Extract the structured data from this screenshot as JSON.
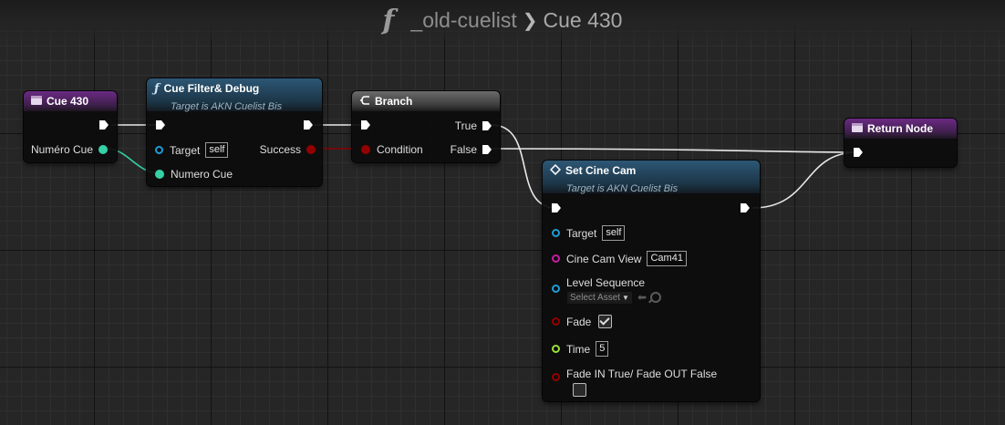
{
  "title_bar": {
    "function_glyph": "f",
    "graph_name": "_old-cuelist",
    "separator": "❯",
    "current": "Cue 430"
  },
  "nodes": {
    "cue430": {
      "title": "Cue 430",
      "icon": "event-icon",
      "pins": {
        "numero_cue": "Numéro Cue"
      }
    },
    "cue_filter": {
      "title": "Cue Filter& Debug",
      "subtitle": "Target is AKN Cuelist Bis",
      "icon": "function-icon",
      "pins": {
        "target": "Target",
        "target_value": "self",
        "success": "Success",
        "numero_cue": "Numero Cue"
      }
    },
    "branch": {
      "title": "Branch",
      "icon": "branch-icon",
      "pins": {
        "true": "True",
        "false": "False",
        "condition": "Condition"
      }
    },
    "return_node": {
      "title": "Return Node",
      "icon": "event-icon"
    },
    "set_cine_cam": {
      "title": "Set Cine Cam",
      "subtitle": "Target is AKN Cuelist Bis",
      "icon": "diamond-icon",
      "pins": {
        "target": "Target",
        "target_value": "self",
        "cine_cam_view": "Cine Cam View",
        "cine_cam_value": "Cam41",
        "level_sequence": "Level Sequence",
        "select_asset": "Select Asset",
        "fade": "Fade",
        "fade_checked": true,
        "time": "Time",
        "time_value": "5",
        "fade_in_out": "Fade IN True/ Fade OUT False",
        "fade_in_out_checked": false
      }
    }
  },
  "colors": {
    "exec": "#ffffff",
    "object_pin": "#1e9cd6",
    "float_pin": "#35d0a5",
    "bool_pin": "#940000",
    "cine_cam_pin": "#c21ea4",
    "time_pin": "#9ae03a",
    "purple_header": "#6b2a84",
    "blue_header": "#2d5775",
    "gray_header": "#6b6b6b"
  }
}
